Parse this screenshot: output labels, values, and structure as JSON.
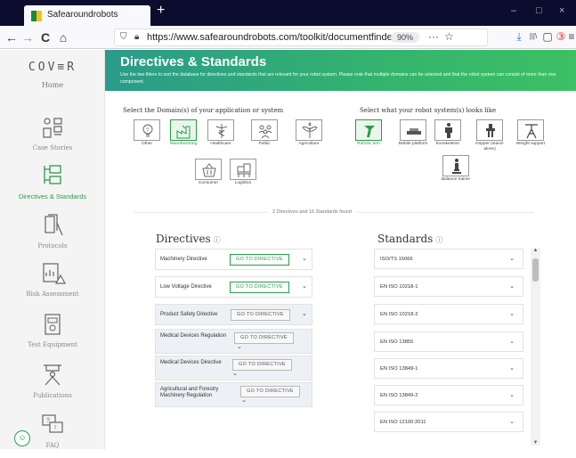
{
  "browser": {
    "tab_title": "Safearoundrobots",
    "tab_close": "×",
    "new_tab": "+",
    "window_buttons": [
      "–",
      "□",
      "×"
    ],
    "url": "https://www.safearoundrobots.com/toolkit/documentfinder",
    "zoom": "90%",
    "page_actions": "···",
    "bookmark_star": "☆",
    "nav": {
      "back": "←",
      "forward": "→",
      "reload": "C",
      "home": "⌂"
    },
    "toolbar_icons": [
      "⤓",
      "|||\\",
      "▢",
      "③",
      "≡"
    ]
  },
  "sidebar": {
    "logo": "COV≡R",
    "logo_sub": "Home",
    "items": [
      {
        "label": "Case Stories"
      },
      {
        "label": "Directives & Standards"
      },
      {
        "label": "Protocols"
      },
      {
        "label": "Risk Assessment"
      },
      {
        "label": "Test Equipment"
      },
      {
        "label": "Publications"
      },
      {
        "label": "FAQ"
      }
    ]
  },
  "header": {
    "title": "Directives & Standards",
    "subtitle": "Use the two filters to sort the database for directives and standards that are relevant for your robot system. Please note that multiple domains can be selected and that the robot system can consist of more than one component."
  },
  "domain_filter": {
    "title": "Select the Domain(s) of your application or system",
    "options": [
      {
        "label": "Other",
        "icon": "question-lightbulb-icon",
        "selected": false
      },
      {
        "label": "Manufacturing",
        "icon": "manufacturing-icon",
        "selected": true
      },
      {
        "label": "Healthcare",
        "icon": "caduceus-icon",
        "selected": false
      },
      {
        "label": "Public",
        "icon": "people-icon",
        "selected": false
      },
      {
        "label": "Agriculture",
        "icon": "plant-icon",
        "selected": false
      },
      {
        "label": "Consumer",
        "icon": "shopping-basket-icon",
        "selected": false
      },
      {
        "label": "Logistics",
        "icon": "pallet-boxes-icon",
        "selected": false
      }
    ]
  },
  "system_filter": {
    "title": "Select what your robot system(s) looks like",
    "options": [
      {
        "label": "Robotic arm",
        "icon": "robotic-arm-icon",
        "selected": true
      },
      {
        "label": "Mobile platform",
        "icon": "mobile-platform-icon",
        "selected": false
      },
      {
        "label": "Exoskeleton",
        "icon": "exoskeleton-icon",
        "selected": false
      },
      {
        "label": "Gripper (stand-alone)",
        "icon": "gripper-icon",
        "selected": false
      },
      {
        "label": "Weight support",
        "icon": "weight-support-icon",
        "selected": false
      },
      {
        "label": "Balance trainer",
        "icon": "balance-trainer-icon",
        "selected": false
      }
    ]
  },
  "results_summary": "2 Directives and 16 Standards found",
  "directives": {
    "title": "Directives",
    "info_icon": "ⓘ",
    "button_label": "GO TO DIRECTIVE",
    "items": [
      {
        "name": "Machinery Directive",
        "highlighted": true
      },
      {
        "name": "Low Voltage Directive",
        "highlighted": true
      },
      {
        "name": "Product Safety Directive",
        "highlighted": false
      },
      {
        "name": "Medical Devices Regulation",
        "highlighted": false
      },
      {
        "name": "Medical Devices Directive",
        "highlighted": false
      },
      {
        "name": "Agricultural and Forestry Machinery Regulation",
        "highlighted": false
      }
    ]
  },
  "standards": {
    "title": "Standards",
    "info_icon": "ⓘ",
    "items": [
      "ISO/TS 15066",
      "EN ISO 10218-1",
      "EN ISO 10218-2",
      "EN ISO 13855",
      "EN ISO 13849-1",
      "EN ISO 13849-2",
      "EN ISO 12100:2011"
    ]
  },
  "colors": {
    "accent_green": "#2a9b4a",
    "header_gradient_start": "#2a9b8a",
    "header_gradient_end": "#3cc064",
    "tabbar": "#0c0c2e"
  }
}
